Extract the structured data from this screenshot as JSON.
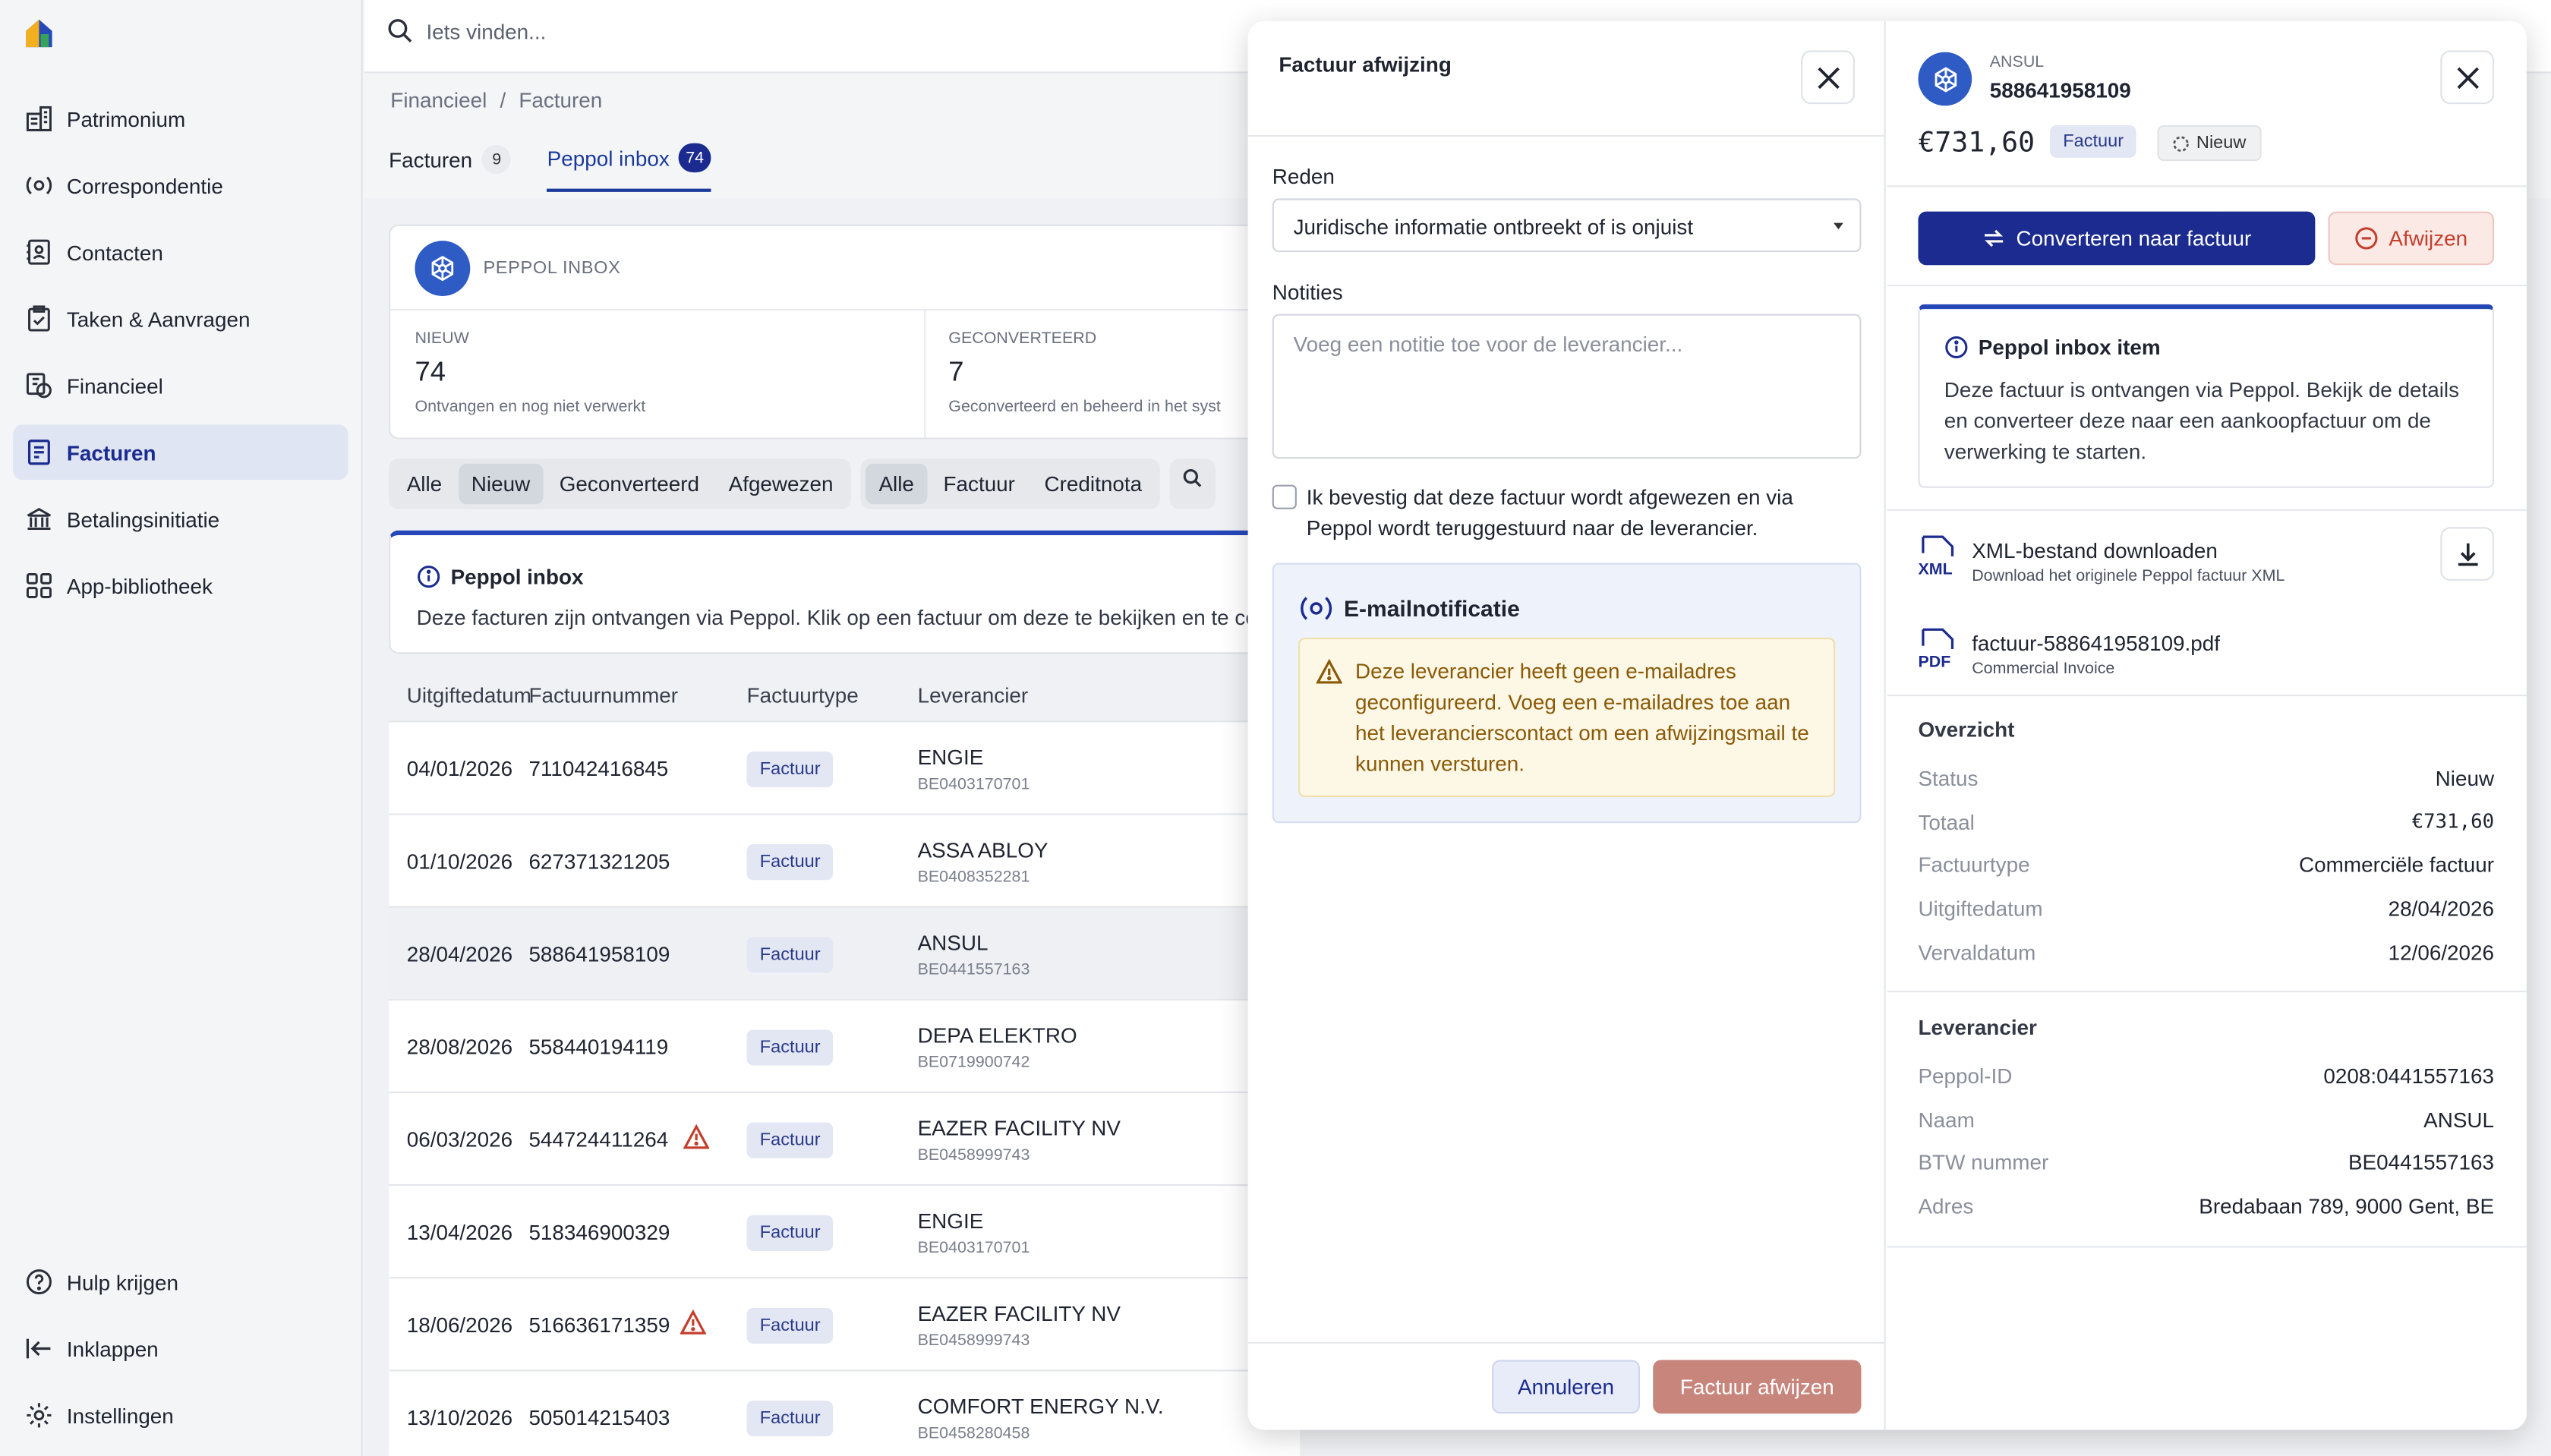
{
  "search": {
    "placeholder": "Iets vinden..."
  },
  "sidebar": {
    "items": [
      {
        "label": "Patrimonium",
        "icon": "building-icon"
      },
      {
        "label": "Correspondentie",
        "icon": "broadcast-icon"
      },
      {
        "label": "Contacten",
        "icon": "address-book-icon"
      },
      {
        "label": "Taken & Aanvragen",
        "icon": "clipboard-check-icon"
      },
      {
        "label": "Financieel",
        "icon": "finance-icon"
      },
      {
        "label": "Facturen",
        "icon": "invoice-icon"
      },
      {
        "label": "Betalingsinitiatie",
        "icon": "bank-icon"
      },
      {
        "label": "App-bibliotheek",
        "icon": "apps-grid-icon"
      }
    ],
    "bottom": [
      {
        "label": "Hulp krijgen",
        "icon": "help-icon"
      },
      {
        "label": "Inklappen",
        "icon": "collapse-icon"
      },
      {
        "label": "Instellingen",
        "icon": "gear-icon"
      }
    ]
  },
  "breadcrumb": {
    "first": "Financieel",
    "sep": "/",
    "second": "Facturen"
  },
  "tabs": [
    {
      "label": "Facturen",
      "count": "9"
    },
    {
      "label": "Peppol inbox",
      "count": "74"
    }
  ],
  "stats": {
    "header": "PEPPOL INBOX",
    "new_label": "NIEUW",
    "new_value": "74",
    "new_desc": "Ontvangen en nog niet verwerkt",
    "conv_label": "GECONVERTEERD",
    "conv_value": "7",
    "conv_desc": "Geconverteerd en beheerd in het syst"
  },
  "filters": {
    "status": [
      "Alle",
      "Nieuw",
      "Geconverteerd",
      "Afgewezen"
    ],
    "type": [
      "Alle",
      "Factuur",
      "Creditnota"
    ]
  },
  "info": {
    "title": "Peppol inbox",
    "text": "Deze facturen zijn ontvangen via Peppol. Klik op een factuur om deze te bekijken en te co"
  },
  "table": {
    "headers": [
      "Uitgiftedatum",
      "Factuurnummer",
      "Factuurtype",
      "Leverancier"
    ],
    "rows": [
      {
        "date": "04/01/2026",
        "number": "711042416845",
        "type": "Factuur",
        "supplier": "ENGIE",
        "vat": "BE0403170701"
      },
      {
        "date": "01/10/2026",
        "number": "627371321205",
        "type": "Factuur",
        "supplier": "ASSA ABLOY",
        "vat": "BE0408352281"
      },
      {
        "date": "28/04/2026",
        "number": "588641958109",
        "type": "Factuur",
        "supplier": "ANSUL",
        "vat": "BE0441557163"
      },
      {
        "date": "28/08/2026",
        "number": "558440194119",
        "type": "Factuur",
        "supplier": "DEPA ELEKTRO",
        "vat": "BE0719900742"
      },
      {
        "date": "06/03/2026",
        "number": "544724411264",
        "type": "Factuur",
        "supplier": "EAZER FACILITY NV",
        "vat": "BE0458999743"
      },
      {
        "date": "13/04/2026",
        "number": "518346900329",
        "type": "Factuur",
        "supplier": "ENGIE",
        "vat": "BE0403170701"
      },
      {
        "date": "18/06/2026",
        "number": "516636171359",
        "type": "Factuur",
        "supplier": "EAZER FACILITY NV",
        "vat": "BE0458999743"
      },
      {
        "date": "13/10/2026",
        "number": "505014215403",
        "type": "Factuur",
        "supplier": "COMFORT ENERGY N.V.",
        "vat": "BE0458280458"
      }
    ]
  },
  "reject": {
    "title": "Factuur afwijzing",
    "reason_label": "Reden",
    "reason_value": "Juridische informatie ontbreekt of is onjuist",
    "notes_label": "Notities",
    "notes_placeholder": "Voeg een notitie toe voor de leverancier...",
    "confirm_text": "Ik bevestig dat deze factuur wordt afgewezen en via Peppol wordt teruggestuurd naar de leverancier.",
    "email_title": "E-mailnotificatie",
    "email_warning": "Deze leverancier heeft geen e-mailadres geconfigureerd. Voeg een e-mailadres toe aan het leverancierscontact om een afwijzingsmail te kunnen versturen.",
    "cancel": "Annuleren",
    "submit": "Factuur afwijzen"
  },
  "detail": {
    "supplier": "ANSUL",
    "number": "588641958109",
    "amount": "€731,60",
    "type_tag": "Factuur",
    "status_tag": "Nieuw",
    "convert": "Converteren naar factuur",
    "reject": "Afwijzen",
    "peppol_title": "Peppol inbox item",
    "peppol_text": "Deze factuur is ontvangen via Peppol. Bekijk de details en converteer deze naar een aankoopfactuur om de verwerking te starten.",
    "xml_name": "XML-bestand downloaden",
    "xml_sub": "Download het originele Peppol factuur XML",
    "xml_icon": "XML",
    "pdf_name": "factuur-588641958109.pdf",
    "pdf_sub": "Commercial Invoice",
    "pdf_icon": "PDF",
    "overview_title": "Overzicht",
    "overview": [
      {
        "k": "Status",
        "v": "Nieuw"
      },
      {
        "k": "Totaal",
        "v": "€731,60"
      },
      {
        "k": "Factuurtype",
        "v": "Commerciële factuur"
      },
      {
        "k": "Uitgiftedatum",
        "v": "28/04/2026"
      },
      {
        "k": "Vervaldatum",
        "v": "12/06/2026"
      }
    ],
    "supplier_title": "Leverancier",
    "supplier_info": [
      {
        "k": "Peppol-ID",
        "v": "0208:0441557163"
      },
      {
        "k": "Naam",
        "v": "ANSUL"
      },
      {
        "k": "BTW nummer",
        "v": "BE0441557163"
      },
      {
        "k": "Adres",
        "v": "Bredabaan 789, 9000 Gent, BE"
      }
    ]
  },
  "colors": {
    "accent": "#1b2b8f",
    "danger": "#c43e2c",
    "warning_bg": "#fdf7e6"
  }
}
